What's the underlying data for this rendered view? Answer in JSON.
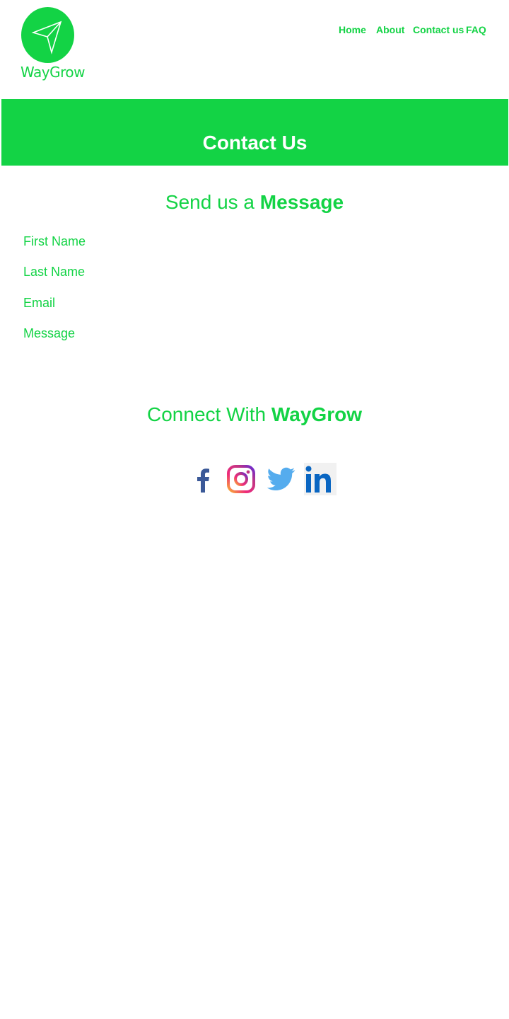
{
  "brand": {
    "name": "WayGrow",
    "logo_icon": "paper-plane-icon",
    "color": "#13d345"
  },
  "nav": {
    "items": [
      {
        "label": "Home"
      },
      {
        "label": "About"
      },
      {
        "label": "Contact us"
      },
      {
        "label": "FAQ"
      }
    ]
  },
  "banner": {
    "title": "Contact Us"
  },
  "form": {
    "heading_prefix": "Send us a",
    "heading_bold": "Message",
    "fields": [
      {
        "placeholder": "First Name",
        "value": ""
      },
      {
        "placeholder": "Last Name",
        "value": ""
      },
      {
        "placeholder": "Email",
        "value": ""
      },
      {
        "placeholder": "Message",
        "value": ""
      }
    ]
  },
  "connect": {
    "heading_prefix": "Connect With",
    "heading_bold": "WayGrow",
    "icons": [
      "facebook-icon",
      "instagram-icon",
      "twitter-icon",
      "linkedin-icon"
    ]
  }
}
